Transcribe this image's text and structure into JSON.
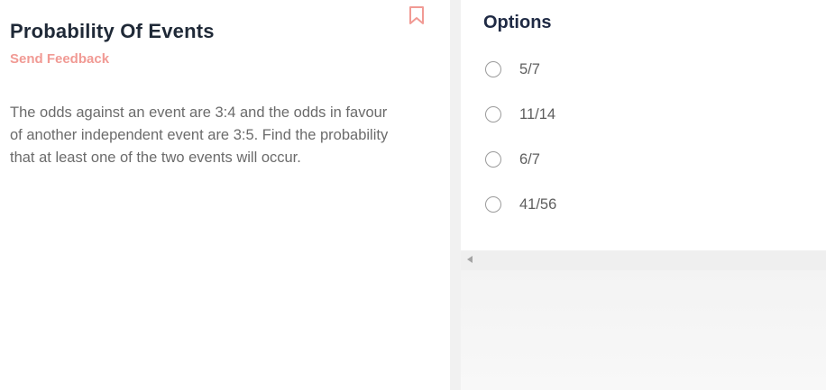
{
  "question": {
    "title": "Probability Of Events",
    "feedback_label": "Send Feedback",
    "text": "The odds against an event are 3:4 and the odds in favour of another independent event are 3:5. Find the probability that at least one of the two events will occur.",
    "bookmark_icon": "bookmark-icon"
  },
  "options": {
    "title": "Options",
    "items": [
      {
        "label": "5/7",
        "selected": false
      },
      {
        "label": "11/14",
        "selected": false
      },
      {
        "label": "6/7",
        "selected": false
      },
      {
        "label": "41/56",
        "selected": false
      }
    ]
  },
  "colors": {
    "accent": "#f19a94",
    "title": "#1f2937",
    "body_text": "#6b6b6b"
  }
}
